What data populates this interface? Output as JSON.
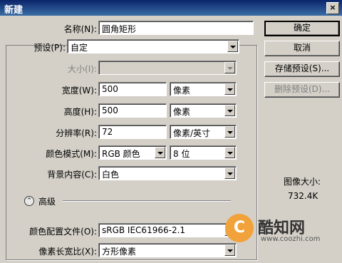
{
  "window": {
    "title": "新建",
    "close_glyph": "×"
  },
  "form": {
    "name": {
      "label": "名称(N):",
      "value": "圆角矩形"
    },
    "preset": {
      "label": "预设(P):",
      "value": "自定"
    },
    "size": {
      "label": "大小(I):",
      "value": ""
    },
    "width": {
      "label": "宽度(W):",
      "value": "500",
      "unit": "像素"
    },
    "height": {
      "label": "高度(H):",
      "value": "500",
      "unit": "像素"
    },
    "resolution": {
      "label": "分辨率(R):",
      "value": "72",
      "unit": "像素/英寸"
    },
    "color_mode": {
      "label": "颜色模式(M):",
      "value": "RGB 颜色",
      "depth": "8 位"
    },
    "background": {
      "label": "背景内容(C):",
      "value": "白色"
    },
    "advanced": {
      "label": "高级",
      "toggle_glyph": "⌃"
    },
    "color_profile": {
      "label": "颜色配置文件(O):",
      "value": "sRGB IEC61966-2.1"
    },
    "pixel_aspect": {
      "label": "像素长宽比(X):",
      "value": "方形像素"
    }
  },
  "buttons": {
    "ok": "确定",
    "cancel": "取消",
    "save_preset": "存储预设(S)...",
    "delete_preset": "删除预设(D)..."
  },
  "image_size": {
    "label": "图像大小:",
    "value": "732.4K"
  },
  "watermark": {
    "logo_glyph": "C",
    "name": "酷知网",
    "url": "www.coozhi.com"
  }
}
